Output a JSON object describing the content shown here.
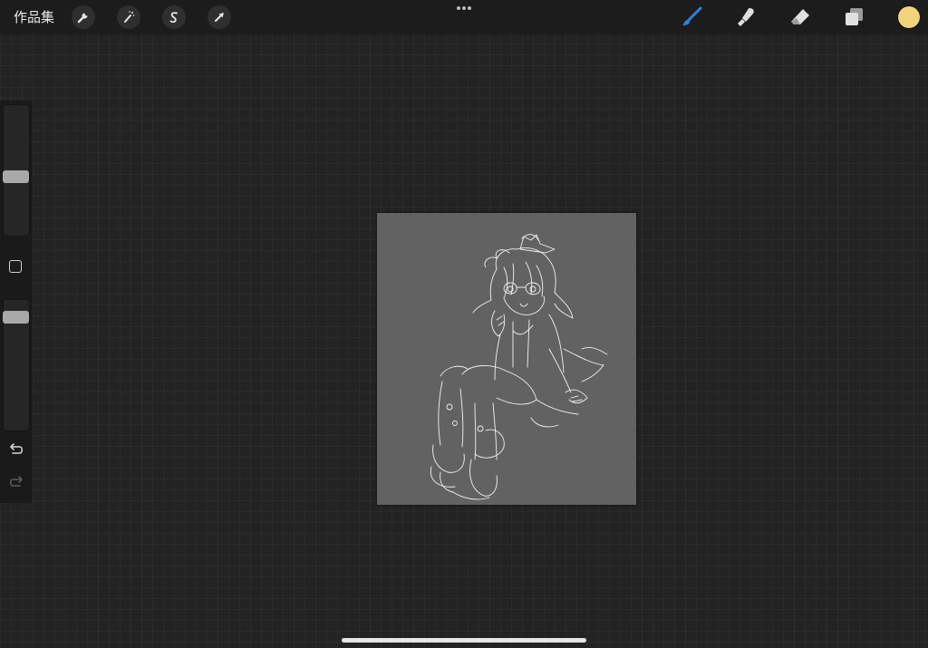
{
  "topbar": {
    "gallery_label": "作品集",
    "left_tools": [
      {
        "name": "actions",
        "icon": "wrench-icon"
      },
      {
        "name": "adjustments",
        "icon": "magic-wand-icon"
      },
      {
        "name": "selection",
        "icon": "selection-s-icon"
      },
      {
        "name": "transform",
        "icon": "arrow-cursor-icon"
      }
    ],
    "more_icon": "more-dots-icon",
    "right_tools": [
      {
        "name": "brush",
        "icon": "brush-icon",
        "active": true
      },
      {
        "name": "smudge",
        "icon": "smudge-finger-icon"
      },
      {
        "name": "eraser",
        "icon": "eraser-icon"
      },
      {
        "name": "layers",
        "icon": "layers-icon"
      }
    ],
    "current_color": "#f2d27a",
    "active_color": "#2f7fe0"
  },
  "sidebar": {
    "brush_size_level": 0.45,
    "opacity_level": 0.9,
    "modify_icon": "square-modify-icon",
    "undo_icon": "undo-icon",
    "redo_icon": "redo-icon"
  },
  "canvas": {
    "background_color": "#626262",
    "sketch_color": "#f2f2f2"
  }
}
